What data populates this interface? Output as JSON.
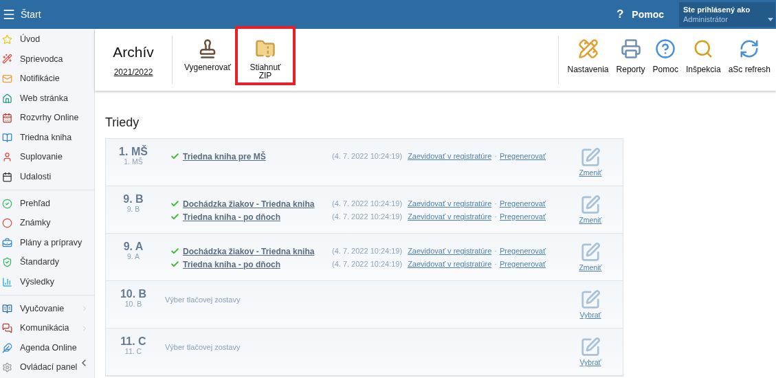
{
  "header": {
    "menu_title": "Štart",
    "help_label": "Pomoc",
    "help_glyph": "?",
    "user_caption": "Ste prihlásený ako",
    "user_name": "Administrátor"
  },
  "sidebar": {
    "groups": [
      {
        "items": [
          {
            "label": "Úvod",
            "submenu": false
          },
          {
            "label": "Sprievodca",
            "submenu": false
          },
          {
            "label": "Notifikácie",
            "submenu": false
          },
          {
            "label": "Web stránka",
            "submenu": false
          },
          {
            "label": "Rozvrhy Online",
            "submenu": false
          },
          {
            "label": "Triedna kniha",
            "submenu": false
          },
          {
            "label": "Suplovanie",
            "submenu": false
          },
          {
            "label": "Udalosti",
            "submenu": false
          }
        ]
      },
      {
        "items": [
          {
            "label": "Prehľad",
            "submenu": false
          },
          {
            "label": "Známky",
            "submenu": false
          },
          {
            "label": "Plány a prípravy",
            "submenu": false
          },
          {
            "label": "Štandardy",
            "submenu": false
          },
          {
            "label": "Výsledky",
            "submenu": false
          }
        ]
      },
      {
        "items": [
          {
            "label": "Vyučovanie",
            "submenu": true
          },
          {
            "label": "Komunikácia",
            "submenu": true
          },
          {
            "label": "Agenda Online",
            "submenu": false
          },
          {
            "label": "Ovládací panel",
            "submenu": false
          }
        ]
      }
    ]
  },
  "toolbar": {
    "title": "Archív",
    "year": "2021/2022",
    "left_actions": [
      {
        "label": "Vygenerovať",
        "highlighted": false
      },
      {
        "label": "Stiahnuť ZIP",
        "highlighted": true
      }
    ],
    "right_actions": [
      {
        "label": "Nastavenia"
      },
      {
        "label": "Reporty"
      },
      {
        "label": "Pomoc"
      },
      {
        "label": "Inšpekcia"
      },
      {
        "label": "aSc refresh"
      }
    ]
  },
  "section_title": "Triedy",
  "classes": [
    {
      "name": "1. MŠ",
      "subname": "1. MŠ",
      "action": "Zmeniť",
      "reports": [
        {
          "title": "Triedna kniha pre MŠ",
          "time": "(4. 7. 2022 10:24:19)",
          "register": "Zaevidovať v registratúre",
          "separator": "·",
          "regenerate": "Pregenerovať"
        }
      ]
    },
    {
      "name": "9. B",
      "subname": "9. B",
      "action": "Zmeniť",
      "reports": [
        {
          "title": "Dochádzka žiakov - Triedna kniha",
          "time": "(4. 7. 2022 10:24:19)",
          "register": "Zaevidovať v registratúre",
          "separator": "·",
          "regenerate": "Pregenerovať"
        },
        {
          "title": "Triedna kniha - po dňoch",
          "time": "(4. 7. 2022 10:24:19)",
          "register": "Zaevidovať v registratúre",
          "separator": "·",
          "regenerate": "Pregenerovať"
        }
      ]
    },
    {
      "name": "9. A",
      "subname": "9. A",
      "action": "Zmeniť",
      "reports": [
        {
          "title": "Dochádzka žiakov - Triedna kniha",
          "time": "(4. 7. 2022 10:24:19)",
          "register": "Zaevidovať v registratúre",
          "separator": "·",
          "regenerate": "Pregenerovať"
        },
        {
          "title": "Triedna kniha - po dňoch",
          "time": "(4. 7. 2022 10:24:19)",
          "register": "Zaevidovať v registratúre",
          "separator": "·",
          "regenerate": "Pregenerovať"
        }
      ]
    },
    {
      "name": "10. B",
      "subname": "10. B",
      "action": "Vybrať",
      "note": "Výber tlačovej zostavy"
    },
    {
      "name": "11. C",
      "subname": "11. C",
      "action": "Vybrať",
      "note": "Výber tlačovej zostavy"
    }
  ]
}
